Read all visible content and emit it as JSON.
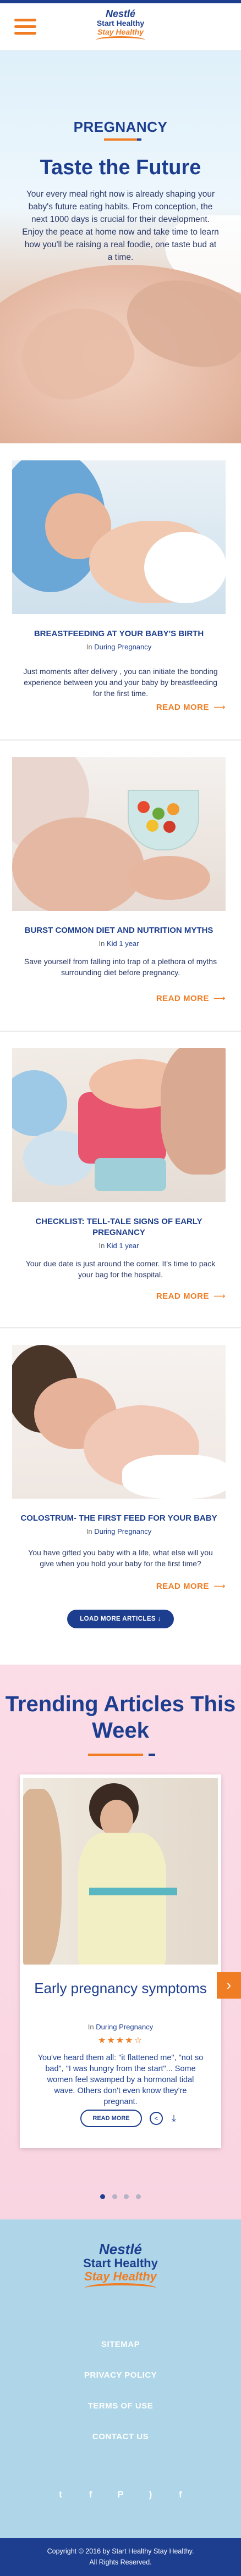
{
  "header": {
    "logo": {
      "line1": "Nestlé",
      "line2": "Start Healthy",
      "line3": "Stay Healthy"
    }
  },
  "hero": {
    "label": "PREGNANCY",
    "heading": "Taste the Future",
    "text": "Your every meal right now is already shaping your baby's future eating habits. From conception, the next 1000 days is crucial for their development. Enjoy the peace at home now and take time to learn how you'll be raising a real foodie, one taste bud at a time."
  },
  "articles": [
    {
      "title": "BREASTFEEDING AT YOUR BABY'S BIRTH",
      "category_prefix": "In",
      "category": "During Pregnancy",
      "desc": "Just moments after delivery , you can initiate the bonding experience between you and your baby by breastfeeding for the first time.",
      "readmore": "READ MORE"
    },
    {
      "title": "BURST COMMON DIET AND NUTRITION MYTHS",
      "category_prefix": "In",
      "category": "Kid 1 year",
      "desc": "Save yourself from falling into trap of a plethora of myths surrounding diet before pregnancy.",
      "readmore": "READ MORE"
    },
    {
      "title": "CHECKLIST: TELL-TALE SIGNS OF EARLY PREGNANCY",
      "category_prefix": "In",
      "category": "Kid 1 year",
      "desc": "Your due date is just around the corner. It's time to pack your bag for the hospital.",
      "readmore": "READ MORE"
    },
    {
      "title": "COLOSTRUM- THE FIRST FEED  FOR YOUR BABY",
      "category_prefix": "In",
      "category": "During Pregnancy",
      "desc": "You have gifted you baby with a life, what else will you give when you hold your baby for the first time?",
      "readmore": "READ MORE"
    }
  ],
  "load_more": "LOAD MORE ARTICLES",
  "trending": {
    "heading": "Trending Articles This Week",
    "card": {
      "title": "Early pregnancy symptoms",
      "category_prefix": "In",
      "category": "During Pregnancy",
      "rating": 4,
      "rating_max": 5,
      "stars": "★★★★☆",
      "desc": "You've heard them all: \"it flattened me\", \"not so bad\", \"I was hungry from the start\"... Some women feel swamped by a hormonal tidal wave. Others don't even know they're pregnant.",
      "button": "READ MORE"
    },
    "dots": 4,
    "active_dot": 0
  },
  "footer": {
    "logo": {
      "line1": "Nestlé",
      "line2": "Start Healthy",
      "line3": "Stay Healthy"
    },
    "links": [
      "SITEMAP",
      "PRIVACY POLICY",
      "TERMS OF USE",
      "CONTACT US"
    ],
    "social": [
      "twitter",
      "facebook",
      "pinterest",
      "rss",
      "facebook-f"
    ],
    "copyright_line1": "Copyright © 2016 by Start Healthy Stay Healthy.",
    "copyright_line2": "All Rights Reserved."
  },
  "colors": {
    "primary": "#1d3e8f",
    "accent": "#f07c23",
    "trending_bg": "#fbdde7",
    "footer_bg": "#aed6e8"
  }
}
